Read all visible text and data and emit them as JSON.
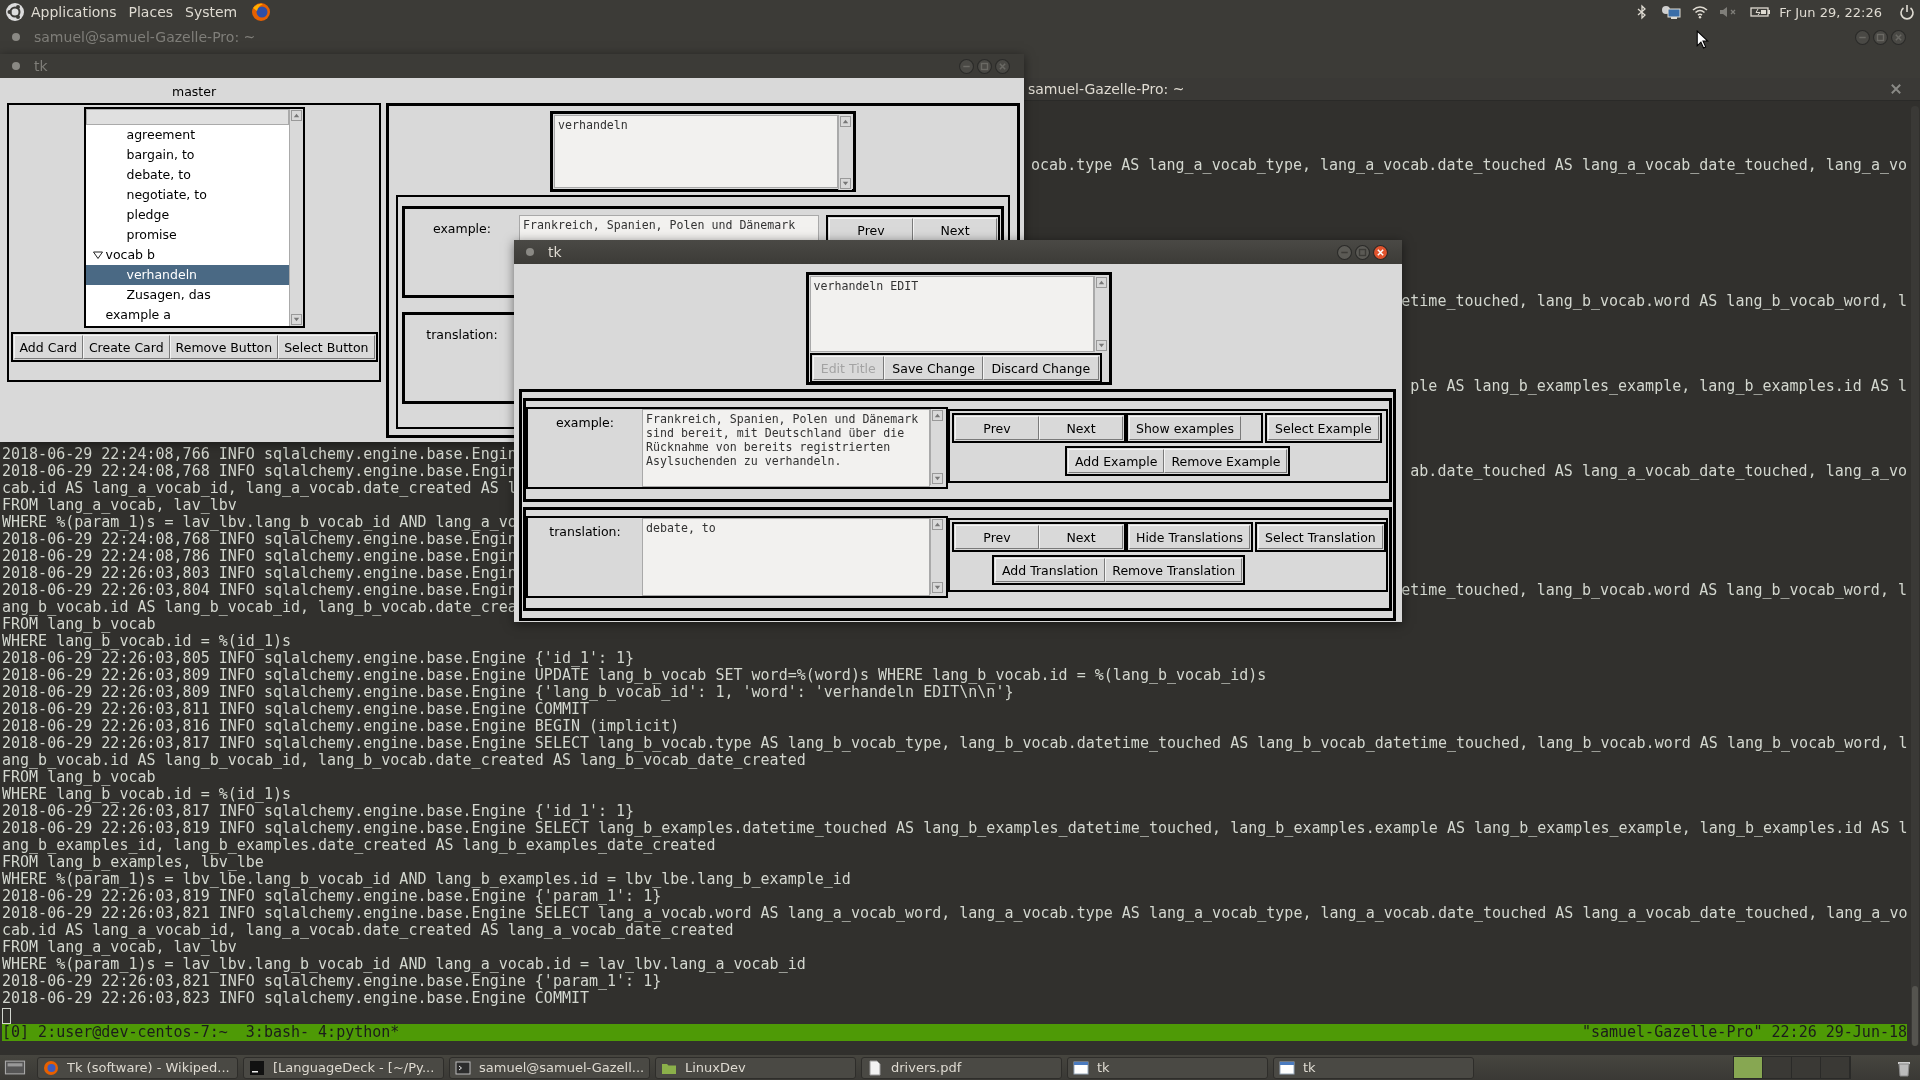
{
  "top_panel": {
    "menus": [
      "Applications",
      "Places",
      "System"
    ],
    "clock": "Fr Jun 29, 22:26"
  },
  "terminal": {
    "title": "samuel@samuel-Gazelle-Pro: ~",
    "tab_title": "samuel-Gazelle-Pro: ~",
    "upper_fragments": [
      "ocab.type AS lang_a_vocab_type, lang_a_vocab.date_touched AS lang_a_vocab_date_touched, lang_a_vo",
      "etime_touched, lang_b_vocab.word AS lang_b_vocab_word, l",
      "ple AS lang_b_examples_example, lang_b_examples.id AS l"
    ],
    "lines": [
      {
        "left": "2018-06-29 22:24:08,766 INFO sqlalchemy.engine.base.Engin"
      },
      {
        "left": "2018-06-29 22:24:08,768 INFO sqlalchemy.engine.base.Engin",
        "right": "ab.date_touched AS lang_a_vocab_date_touched, lang_a_vo"
      },
      {
        "left": "cab.id AS lang_a_vocab_id, lang_a_vocab.date_created AS l"
      },
      {
        "left": "FROM lang_a_vocab, lav_lbv"
      },
      {
        "left": "WHERE %(param_1)s = lav_lbv.lang_b_vocab_id AND lang_a_vo"
      },
      {
        "left": "2018-06-29 22:24:08,768 INFO sqlalchemy.engine.base.Engin"
      },
      {
        "left": "2018-06-29 22:24:08,786 INFO sqlalchemy.engine.base.Engin"
      },
      {
        "left": "2018-06-29 22:26:03,803 INFO sqlalchemy.engine.base.Engin"
      },
      {
        "left": "2018-06-29 22:26:03,804 INFO sqlalchemy.engine.base.Engin",
        "right": "etime_touched, lang_b_vocab.word AS lang_b_vocab_word, l"
      },
      {
        "left": "ang_b_vocab.id AS lang_b_vocab_id, lang_b_vocab.date_crea"
      },
      {
        "text": "FROM lang_b_vocab"
      },
      {
        "text": "WHERE lang_b_vocab.id = %(id_1)s"
      },
      {
        "text": "2018-06-29 22:26:03,805 INFO sqlalchemy.engine.base.Engine {'id_1': 1}"
      },
      {
        "text": "2018-06-29 22:26:03,809 INFO sqlalchemy.engine.base.Engine UPDATE lang_b_vocab SET word=%(word)s WHERE lang_b_vocab.id = %(lang_b_vocab_id)s"
      },
      {
        "text": "2018-06-29 22:26:03,809 INFO sqlalchemy.engine.base.Engine {'lang_b_vocab_id': 1, 'word': 'verhandeln EDIT\\n\\n'}"
      },
      {
        "text": "2018-06-29 22:26:03,811 INFO sqlalchemy.engine.base.Engine COMMIT"
      },
      {
        "text": "2018-06-29 22:26:03,816 INFO sqlalchemy.engine.base.Engine BEGIN (implicit)"
      },
      {
        "text": "2018-06-29 22:26:03,817 INFO sqlalchemy.engine.base.Engine SELECT lang_b_vocab.type AS lang_b_vocab_type, lang_b_vocab.datetime_touched AS lang_b_vocab_datetime_touched, lang_b_vocab.word AS lang_b_vocab_word, l"
      },
      {
        "text": "ang_b_vocab.id AS lang_b_vocab_id, lang_b_vocab.date_created AS lang_b_vocab_date_created"
      },
      {
        "text": "FROM lang_b_vocab"
      },
      {
        "text": "WHERE lang_b_vocab.id = %(id_1)s"
      },
      {
        "text": "2018-06-29 22:26:03,817 INFO sqlalchemy.engine.base.Engine {'id_1': 1}"
      },
      {
        "text": "2018-06-29 22:26:03,819 INFO sqlalchemy.engine.base.Engine SELECT lang_b_examples.datetime_touched AS lang_b_examples_datetime_touched, lang_b_examples.example AS lang_b_examples_example, lang_b_examples.id AS l"
      },
      {
        "text": "ang_b_examples_id, lang_b_examples.date_created AS lang_b_examples_date_created"
      },
      {
        "text": "FROM lang_b_examples, lbv_lbe"
      },
      {
        "text": "WHERE %(param_1)s = lbv_lbe.lang_b_vocab_id AND lang_b_examples.id = lbv_lbe.lang_b_example_id"
      },
      {
        "text": "2018-06-29 22:26:03,819 INFO sqlalchemy.engine.base.Engine {'param_1': 1}"
      },
      {
        "text": "2018-06-29 22:26:03,821 INFO sqlalchemy.engine.base.Engine SELECT lang_a_vocab.word AS lang_a_vocab_word, lang_a_vocab.type AS lang_a_vocab_type, lang_a_vocab.date_touched AS lang_a_vocab_date_touched, lang_a_vo"
      },
      {
        "text": "cab.id AS lang_a_vocab_id, lang_a_vocab.date_created AS lang_a_vocab_date_created"
      },
      {
        "text": "FROM lang_a_vocab, lav_lbv"
      },
      {
        "text": "WHERE %(param_1)s = lav_lbv.lang_b_vocab_id AND lang_a_vocab.id = lav_lbv.lang_a_vocab_id"
      },
      {
        "text": "2018-06-29 22:26:03,821 INFO sqlalchemy.engine.base.Engine {'param_1': 1}"
      },
      {
        "text": "2018-06-29 22:26:03,823 INFO sqlalchemy.engine.base.Engine COMMIT"
      }
    ],
    "status": {
      "windows": "[0] 2:user@dev-centos-7:~  3:bash- 4:python*",
      "host_time": "\"samuel-Gazelle-Pro\" 22:26 29-Jun-18"
    }
  },
  "main_window": {
    "title": "tk",
    "frame_label": "master",
    "tree": [
      {
        "children": [
          {
            "label": "agreement",
            "selected": false
          },
          {
            "label": "bargain, to",
            "selected": false
          },
          {
            "label": "debate, to",
            "selected": false
          },
          {
            "label": "negotiate, to",
            "selected": false
          },
          {
            "label": "pledge",
            "selected": false
          },
          {
            "label": "promise",
            "selected": false
          }
        ]
      },
      {
        "label": "vocab b",
        "expanded": true,
        "selected": false,
        "children": [
          {
            "label": "verhandeln",
            "selected": true
          },
          {
            "label": "Zusagen, das",
            "selected": false
          }
        ]
      },
      {
        "label": "example a",
        "selected": false
      }
    ],
    "buttons": [
      "Add Card",
      "Create Card",
      "Remove Button",
      "Select Button"
    ],
    "word": "verhandeln",
    "example_label": "example:",
    "example_text": "Frankreich, Spanien, Polen und Dänemark",
    "example_nav": [
      "Prev",
      "Next"
    ],
    "translation_label": "translation:"
  },
  "edit_window": {
    "title": "tk",
    "word": "verhandeln EDIT",
    "title_buttons": [
      {
        "label": "Edit Title",
        "disabled": true
      },
      {
        "label": "Save Change",
        "disabled": false
      },
      {
        "label": "Discard Change",
        "disabled": false
      }
    ],
    "sections": [
      {
        "label": "example:",
        "text": "Frankreich, Spanien, Polen und Dänemark sind bereit, mit Deutschland über die Rücknahme von bereits registrierten Asylsuchenden zu verhandeln.",
        "nav": [
          "Prev",
          "Next"
        ],
        "toggle": "Show examples",
        "select": "Select Example",
        "actions": [
          "Add Example",
          "Remove Example"
        ]
      },
      {
        "label": "translation:",
        "text": "debate, to",
        "nav": [
          "Prev",
          "Next"
        ],
        "toggle": "Hide Translations",
        "select": "Select Translation",
        "actions": [
          "Add Translation",
          "Remove Translation"
        ]
      }
    ]
  },
  "taskbar": {
    "items": [
      {
        "label": "Tk (software) - Wikiped...",
        "kind": "browser"
      },
      {
        "label": "[LanguageDeck - [~/Py...",
        "kind": "ide"
      },
      {
        "label": "samuel@samuel-Gazell...",
        "kind": "terminal"
      },
      {
        "label": "LinuxDev",
        "kind": "folder"
      },
      {
        "label": "drivers.pdf",
        "kind": "document"
      },
      {
        "label": "tk",
        "kind": "window"
      },
      {
        "label": "tk",
        "kind": "window"
      }
    ],
    "workspaces": [
      {
        "selected": true
      },
      {
        "selected": false
      },
      {
        "selected": false
      },
      {
        "selected": false
      }
    ]
  }
}
